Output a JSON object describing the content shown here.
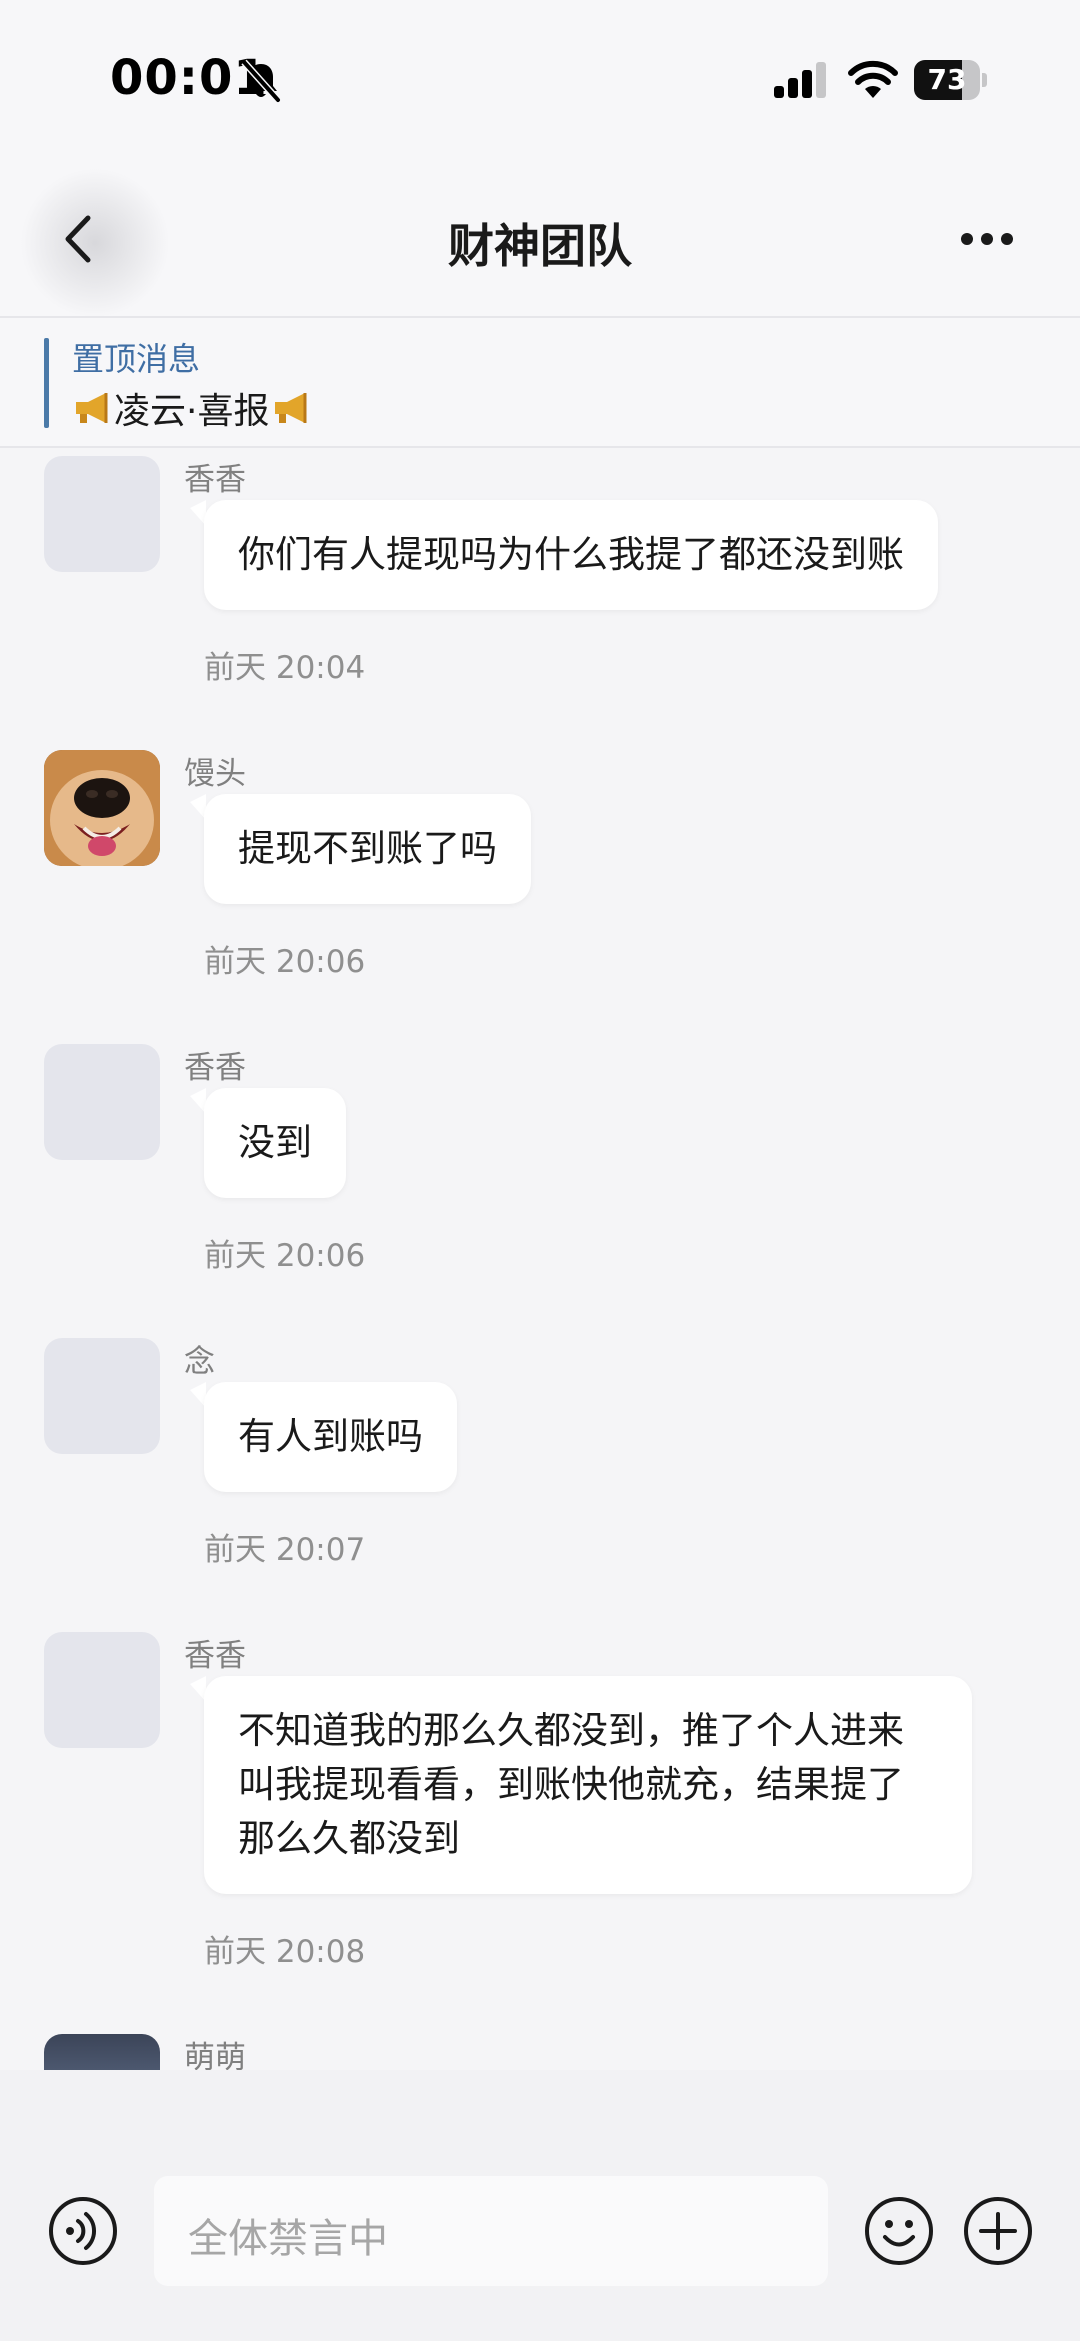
{
  "status_bar": {
    "time": "00:01",
    "battery_level": "73",
    "icons": [
      "mute-bell-icon",
      "cellular-signal-icon",
      "wifi-icon",
      "battery-icon"
    ]
  },
  "header": {
    "title": "财神团队",
    "back_icon": "chevron-left-icon",
    "more_icon": "more-dots-icon"
  },
  "pinned": {
    "label": "置顶消息",
    "text": "凌云·喜报",
    "icon": "megaphone-icon"
  },
  "messages": [
    {
      "sender": "香香",
      "text": "你们有人提现吗为什么我提了都还没到账",
      "time": "前天 20:04",
      "avatar": "placeholder"
    },
    {
      "sender": "馒头",
      "text": "提现不到账了吗",
      "time": "前天 20:06",
      "avatar": "dog-photo"
    },
    {
      "sender": "香香",
      "text": "没到",
      "time": "前天 20:06",
      "avatar": "placeholder"
    },
    {
      "sender": "念",
      "text": "有人到账吗",
      "time": "前天 20:07",
      "avatar": "placeholder"
    },
    {
      "sender": "香香",
      "text": "不知道我的那么久都没到，推了个人进来叫我提现看看，到账快他就充，结果提了那么久都没到",
      "time": "前天 20:08",
      "avatar": "placeholder"
    },
    {
      "sender": "萌萌",
      "text": "",
      "time": "",
      "avatar": "photo"
    }
  ],
  "input_bar": {
    "placeholder": "全体禁言中",
    "icons": [
      "voice-icon",
      "emoji-icon",
      "plus-icon"
    ]
  },
  "colors": {
    "background": "#f5f5f7",
    "bubble": "#ffffff",
    "pinned_accent": "#3f6ea4",
    "secondary_text": "#8f8f8f"
  }
}
